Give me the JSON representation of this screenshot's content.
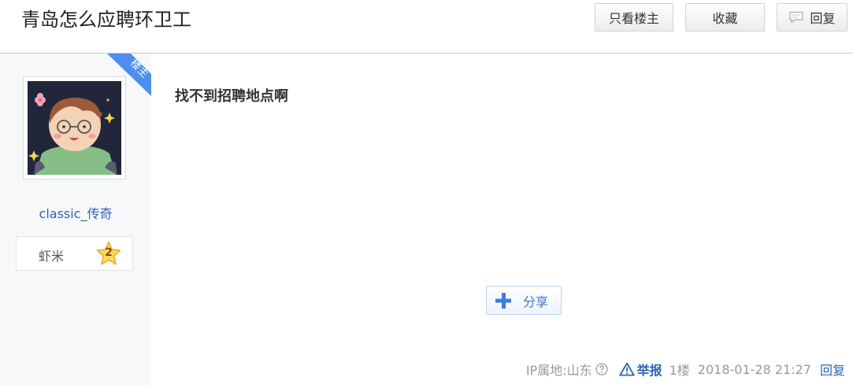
{
  "header": {
    "title": "青岛怎么应聘环卫工",
    "only_op_label": "只看楼主",
    "favorite_label": "收藏",
    "reply_label": "回复"
  },
  "author": {
    "op_badge": "楼主",
    "username": "classic_传奇",
    "level_name": "虾米",
    "level_number": "2"
  },
  "post": {
    "content": "找不到招聘地点啊",
    "share_label": "分享"
  },
  "footer": {
    "ip_location": "IP属地:山东",
    "report_label": "举报",
    "floor": "1楼",
    "time": "2018-01-28 21:27",
    "reply_label": "回复"
  },
  "colors": {
    "link": "#2d64b3",
    "op_badge": "#4d8ef0",
    "muted": "#999999"
  }
}
